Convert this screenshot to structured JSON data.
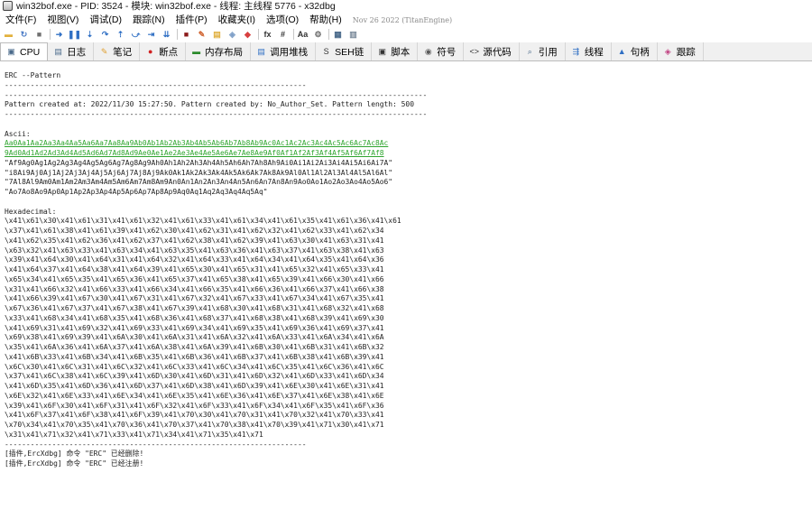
{
  "window": {
    "title": "win32bof.exe - PID: 3524 - 模块: win32bof.exe - 线程: 主线程 5776 - x32dbg"
  },
  "menu": {
    "items": [
      "文件(F)",
      "视图(V)",
      "调试(D)",
      "跟踪(N)",
      "插件(P)",
      "收藏夹(I)",
      "选项(O)",
      "帮助(H)"
    ],
    "build_date": "Nov 26 2022 (TitanEngine)"
  },
  "toolbar": {
    "buttons": [
      {
        "name": "open-icon",
        "glyph": "▬",
        "color": "#e2b13c"
      },
      {
        "name": "restart-icon",
        "glyph": "↻",
        "color": "#4a7bc6"
      },
      {
        "name": "close-icon",
        "glyph": "■",
        "color": "#707070"
      },
      {
        "name": "run-icon",
        "glyph": "➜",
        "color": "#2f6fc4"
      },
      {
        "name": "pause-icon",
        "glyph": "❚❚",
        "color": "#2f6fc4"
      },
      {
        "name": "step-into-icon",
        "glyph": "⇣",
        "color": "#2f6fc4"
      },
      {
        "name": "step-over-icon",
        "glyph": "↷",
        "color": "#2f6fc4"
      },
      {
        "name": "trace-into-icon",
        "glyph": "⇡",
        "color": "#2f6fc4"
      },
      {
        "name": "trace-over-icon",
        "glyph": "⤻",
        "color": "#2f6fc4"
      },
      {
        "name": "execute-till-return-icon",
        "glyph": "⇥",
        "color": "#2f6fc4"
      },
      {
        "name": "run-to-user-code-icon",
        "glyph": "⇊",
        "color": "#2f6fc4"
      },
      {
        "name": "scylla-icon",
        "glyph": "■",
        "color": "#8b1a1a"
      },
      {
        "name": "patch-icon",
        "glyph": "✎",
        "color": "#d0632f"
      },
      {
        "name": "comments-icon",
        "glyph": "▤",
        "color": "#e0b040"
      },
      {
        "name": "labels-icon",
        "glyph": "◈",
        "color": "#7fa0c8"
      },
      {
        "name": "bookmarks-icon",
        "glyph": "◆",
        "color": "#d84040"
      },
      {
        "name": "functions-icon",
        "glyph": "fx",
        "color": "#333333"
      },
      {
        "name": "variables-icon",
        "glyph": "#",
        "color": "#333333"
      },
      {
        "name": "font-icon",
        "glyph": "Aa",
        "color": "#333333"
      },
      {
        "name": "settings-icon",
        "glyph": "⚙",
        "color": "#6a6a6a"
      },
      {
        "name": "calculator-icon",
        "glyph": "▦",
        "color": "#4a6a8a"
      },
      {
        "name": "notepad-icon",
        "glyph": "▥",
        "color": "#7a8a9a"
      }
    ]
  },
  "tabs": [
    {
      "label": "CPU",
      "icon": "cpu-icon",
      "glyph": "▣",
      "color": "#4a6a8a",
      "active": true
    },
    {
      "label": "日志",
      "icon": "log-icon",
      "glyph": "▤",
      "color": "#4a6a8a",
      "active": false
    },
    {
      "label": "笔记",
      "icon": "notes-icon",
      "glyph": "✎",
      "color": "#e0a030",
      "active": false
    },
    {
      "label": "断点",
      "icon": "breakpoints-icon",
      "glyph": "●",
      "color": "#d02020",
      "active": false
    },
    {
      "label": "内存布局",
      "icon": "memory-map-icon",
      "glyph": "▬",
      "color": "#2a8a2a",
      "active": false
    },
    {
      "label": "调用堆栈",
      "icon": "call-stack-icon",
      "glyph": "▤",
      "color": "#2f6fc4",
      "active": false
    },
    {
      "label": "SEH链",
      "icon": "seh-icon",
      "glyph": "S",
      "color": "#333333",
      "active": false
    },
    {
      "label": "脚本",
      "icon": "script-icon",
      "glyph": "▣",
      "color": "#333333",
      "active": false
    },
    {
      "label": "符号",
      "icon": "symbols-icon",
      "glyph": "◉",
      "color": "#5a5a5a",
      "active": false
    },
    {
      "label": "源代码",
      "icon": "source-icon",
      "glyph": "<>",
      "color": "#333333",
      "active": false
    },
    {
      "label": "引用",
      "icon": "references-icon",
      "glyph": "⌕",
      "color": "#4a6a8a",
      "active": false
    },
    {
      "label": "线程",
      "icon": "threads-icon",
      "glyph": "⇶",
      "color": "#2f6fc4",
      "active": false
    },
    {
      "label": "句柄",
      "icon": "handles-icon",
      "glyph": "▲",
      "color": "#2f6fc4",
      "active": false
    },
    {
      "label": "跟踪",
      "icon": "trace-icon",
      "glyph": "◈",
      "color": "#c04080",
      "active": false
    }
  ],
  "log": {
    "lines": [
      {
        "text": "ERC --Pattern",
        "style": "normal"
      },
      {
        "text": "----------------------------------------------------------------------",
        "style": "normal"
      },
      {
        "text": "--------------------------------------------------------------------------------------------------",
        "style": "normal"
      },
      {
        "text": "Pattern created at: 2022/11/30 15:27:50. Pattern created by: No_Author_Set. Pattern length: 500",
        "style": "normal"
      },
      {
        "text": "--------------------------------------------------------------------------------------------------",
        "style": "normal"
      },
      {
        "text": "",
        "style": "normal"
      },
      {
        "text": "Ascii:",
        "style": "normal"
      },
      {
        "text": "Aa0Aa1Aa2Aa3Aa4Aa5Aa6Aa7Aa8Aa9Ab0Ab1Ab2Ab3Ab4Ab5Ab6Ab7Ab8Ab9Ac0Ac1Ac2Ac3Ac4Ac5Ac6Ac7Ac8Ac",
        "style": "green"
      },
      {
        "text": "9Ad0Ad1Ad2Ad3Ad4Ad5Ad6Ad7Ad8Ad9Ae0Ae1Ae2Ae3Ae4Ae5Ae6Ae7Ae8Ae9Af0Af1Af2Af3Af4Af5Af6Af7Af8",
        "style": "green"
      },
      {
        "text": "\"Af9Ag0Ag1Ag2Ag3Ag4Ag5Ag6Ag7Ag8Ag9Ah0Ah1Ah2Ah3Ah4Ah5Ah6Ah7Ah8Ah9Ai0Ai1Ai2Ai3Ai4Ai5Ai6Ai7A\"",
        "style": "normal"
      },
      {
        "text": "\"i8Ai9Aj0Aj1Aj2Aj3Aj4Aj5Aj6Aj7Aj8Aj9Ak0Ak1Ak2Ak3Ak4Ak5Ak6Ak7Ak8Ak9Al0Al1Al2Al3Al4Al5Al6Al\"",
        "style": "normal"
      },
      {
        "text": "\"7Al8Al9Am0Am1Am2Am3Am4Am5Am6Am7Am8Am9An0An1An2An3An4An5An6An7An8An9Ao0Ao1Ao2Ao3Ao4Ao5Ao6\"",
        "style": "normal"
      },
      {
        "text": "\"Ao7Ao8Ao9Ap0Ap1Ap2Ap3Ap4Ap5Ap6Ap7Ap8Ap9Aq0Aq1Aq2Aq3Aq4Aq5Aq\"",
        "style": "normal"
      },
      {
        "text": "",
        "style": "normal"
      },
      {
        "text": "Hexadecimal:",
        "style": "normal"
      },
      {
        "text": "\\x41\\x61\\x30\\x41\\x61\\x31\\x41\\x61\\x32\\x41\\x61\\x33\\x41\\x61\\x34\\x41\\x61\\x35\\x41\\x61\\x36\\x41\\x61",
        "style": "normal"
      },
      {
        "text": "\\x37\\x41\\x61\\x38\\x41\\x61\\x39\\x41\\x62\\x30\\x41\\x62\\x31\\x41\\x62\\x32\\x41\\x62\\x33\\x41\\x62\\x34",
        "style": "normal"
      },
      {
        "text": "\\x41\\x62\\x35\\x41\\x62\\x36\\x41\\x62\\x37\\x41\\x62\\x38\\x41\\x62\\x39\\x41\\x63\\x30\\x41\\x63\\x31\\x41",
        "style": "normal"
      },
      {
        "text": "\\x63\\x32\\x41\\x63\\x33\\x41\\x63\\x34\\x41\\x63\\x35\\x41\\x63\\x36\\x41\\x63\\x37\\x41\\x63\\x38\\x41\\x63",
        "style": "normal"
      },
      {
        "text": "\\x39\\x41\\x64\\x30\\x41\\x64\\x31\\x41\\x64\\x32\\x41\\x64\\x33\\x41\\x64\\x34\\x41\\x64\\x35\\x41\\x64\\x36",
        "style": "normal"
      },
      {
        "text": "\\x41\\x64\\x37\\x41\\x64\\x38\\x41\\x64\\x39\\x41\\x65\\x30\\x41\\x65\\x31\\x41\\x65\\x32\\x41\\x65\\x33\\x41",
        "style": "normal"
      },
      {
        "text": "\\x65\\x34\\x41\\x65\\x35\\x41\\x65\\x36\\x41\\x65\\x37\\x41\\x65\\x38\\x41\\x65\\x39\\x41\\x66\\x30\\x41\\x66",
        "style": "normal"
      },
      {
        "text": "\\x31\\x41\\x66\\x32\\x41\\x66\\x33\\x41\\x66\\x34\\x41\\x66\\x35\\x41\\x66\\x36\\x41\\x66\\x37\\x41\\x66\\x38",
        "style": "normal"
      },
      {
        "text": "\\x41\\x66\\x39\\x41\\x67\\x30\\x41\\x67\\x31\\x41\\x67\\x32\\x41\\x67\\x33\\x41\\x67\\x34\\x41\\x67\\x35\\x41",
        "style": "normal"
      },
      {
        "text": "\\x67\\x36\\x41\\x67\\x37\\x41\\x67\\x38\\x41\\x67\\x39\\x41\\x68\\x30\\x41\\x68\\x31\\x41\\x68\\x32\\x41\\x68",
        "style": "normal"
      },
      {
        "text": "\\x33\\x41\\x68\\x34\\x41\\x68\\x35\\x41\\x68\\x36\\x41\\x68\\x37\\x41\\x68\\x38\\x41\\x68\\x39\\x41\\x69\\x30",
        "style": "normal"
      },
      {
        "text": "\\x41\\x69\\x31\\x41\\x69\\x32\\x41\\x69\\x33\\x41\\x69\\x34\\x41\\x69\\x35\\x41\\x69\\x36\\x41\\x69\\x37\\x41",
        "style": "normal"
      },
      {
        "text": "\\x69\\x38\\x41\\x69\\x39\\x41\\x6A\\x30\\x41\\x6A\\x31\\x41\\x6A\\x32\\x41\\x6A\\x33\\x41\\x6A\\x34\\x41\\x6A",
        "style": "normal"
      },
      {
        "text": "\\x35\\x41\\x6A\\x36\\x41\\x6A\\x37\\x41\\x6A\\x38\\x41\\x6A\\x39\\x41\\x6B\\x30\\x41\\x6B\\x31\\x41\\x6B\\x32",
        "style": "normal"
      },
      {
        "text": "\\x41\\x6B\\x33\\x41\\x6B\\x34\\x41\\x6B\\x35\\x41\\x6B\\x36\\x41\\x6B\\x37\\x41\\x6B\\x38\\x41\\x6B\\x39\\x41",
        "style": "normal"
      },
      {
        "text": "\\x6C\\x30\\x41\\x6C\\x31\\x41\\x6C\\x32\\x41\\x6C\\x33\\x41\\x6C\\x34\\x41\\x6C\\x35\\x41\\x6C\\x36\\x41\\x6C",
        "style": "normal"
      },
      {
        "text": "\\x37\\x41\\x6C\\x38\\x41\\x6C\\x39\\x41\\x6D\\x30\\x41\\x6D\\x31\\x41\\x6D\\x32\\x41\\x6D\\x33\\x41\\x6D\\x34",
        "style": "normal"
      },
      {
        "text": "\\x41\\x6D\\x35\\x41\\x6D\\x36\\x41\\x6D\\x37\\x41\\x6D\\x38\\x41\\x6D\\x39\\x41\\x6E\\x30\\x41\\x6E\\x31\\x41",
        "style": "normal"
      },
      {
        "text": "\\x6E\\x32\\x41\\x6E\\x33\\x41\\x6E\\x34\\x41\\x6E\\x35\\x41\\x6E\\x36\\x41\\x6E\\x37\\x41\\x6E\\x38\\x41\\x6E",
        "style": "normal"
      },
      {
        "text": "\\x39\\x41\\x6F\\x30\\x41\\x6F\\x31\\x41\\x6F\\x32\\x41\\x6F\\x33\\x41\\x6F\\x34\\x41\\x6F\\x35\\x41\\x6F\\x36",
        "style": "normal"
      },
      {
        "text": "\\x41\\x6F\\x37\\x41\\x6F\\x38\\x41\\x6F\\x39\\x41\\x70\\x30\\x41\\x70\\x31\\x41\\x70\\x32\\x41\\x70\\x33\\x41",
        "style": "normal"
      },
      {
        "text": "\\x70\\x34\\x41\\x70\\x35\\x41\\x70\\x36\\x41\\x70\\x37\\x41\\x70\\x38\\x41\\x70\\x39\\x41\\x71\\x30\\x41\\x71",
        "style": "normal"
      },
      {
        "text": "\\x31\\x41\\x71\\x32\\x41\\x71\\x33\\x41\\x71\\x34\\x41\\x71\\x35\\x41\\x71",
        "style": "normal"
      },
      {
        "text": "----------------------------------------------------------------------",
        "style": "normal"
      },
      {
        "text": "[插件,ErcXdbg] 命令 \"ERC\" 已经删除!",
        "style": "normal"
      },
      {
        "text": "[插件,ErcXdbg] 命令 \"ERC\" 已经注册!",
        "style": "normal"
      }
    ]
  }
}
